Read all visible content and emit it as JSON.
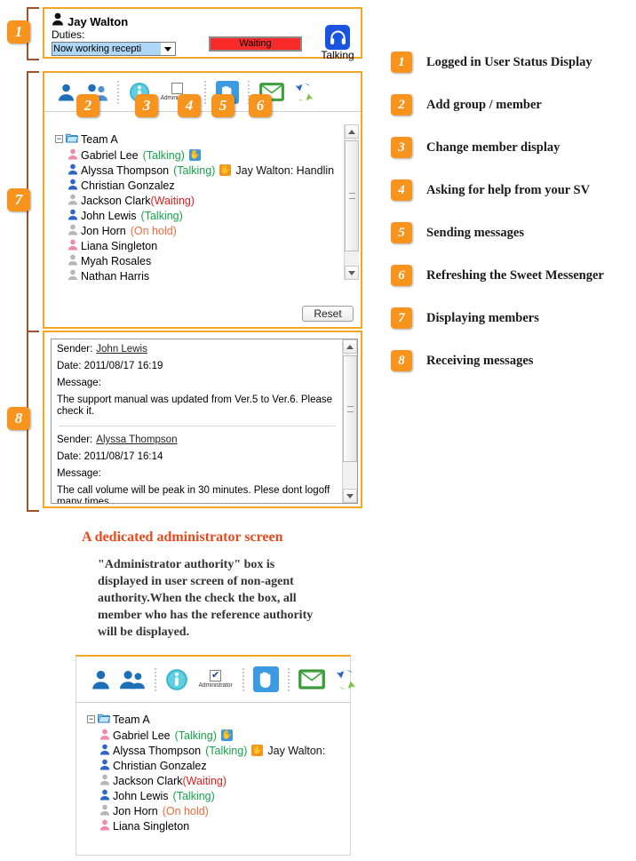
{
  "status": {
    "user_icon": "person-icon",
    "user_name": "Jay Walton",
    "duties_label": "Duties:",
    "duties_value": "Now working recepti",
    "waiting_button": "Waiting",
    "talking_label": "Talking",
    "talking_icon": "headset-icon",
    "waiting_color": "#f82a2a",
    "talking_color": "#1a53e0"
  },
  "toolbar": {
    "add_member_icon": "add-member-icon",
    "add_group_icon": "add-group-icon",
    "info_icon": "info-icon",
    "admin_checkbox_label": "Administrator",
    "admin_checkbox_checked_top": false,
    "admin_checkbox_checked_bottom": true,
    "raise_hand_icon": "raise-hand-icon",
    "mail_icon": "mail-envelope-icon",
    "refresh_icon": "refresh-arrows-icon"
  },
  "tree": {
    "root_label": "Team A",
    "folder_icon": "folder-open-icon",
    "expander": "−",
    "members": [
      {
        "name": "Gabriel Lee",
        "icon_color": "#f08aa8",
        "status": "(Talking)",
        "status_type": "talking",
        "hand": "blue",
        "message": ""
      },
      {
        "name": "Alyssa Thompson",
        "icon_color": "#2e63c8",
        "status": "(Talking)",
        "status_type": "talking",
        "hand": "orange",
        "message": "Jay Walton: Handlin"
      },
      {
        "name": "Christian Gonzalez",
        "icon_color": "#2e63c8",
        "status": "",
        "status_type": "none",
        "hand": "",
        "message": ""
      },
      {
        "name": "Jackson Clark",
        "icon_color": "#b6b6b6",
        "status": "(Waiting)",
        "status_type": "waiting",
        "hand": "",
        "message": ""
      },
      {
        "name": "John Lewis",
        "icon_color": "#2e63c8",
        "status": "(Talking)",
        "status_type": "talking",
        "hand": "",
        "message": ""
      },
      {
        "name": "Jon Horn",
        "icon_color": "#b6b6b6",
        "status": "(On hold)",
        "status_type": "hold",
        "hand": "",
        "message": ""
      },
      {
        "name": "Liana Singleton",
        "icon_color": "#f08aa8",
        "status": "",
        "status_type": "none",
        "hand": "",
        "message": ""
      },
      {
        "name": "Myah Rosales",
        "icon_color": "#b6b6b6",
        "status": "",
        "status_type": "none",
        "hand": "",
        "message": ""
      },
      {
        "name": "Nathan Harris",
        "icon_color": "#b6b6b6",
        "status": "",
        "status_type": "none",
        "hand": "",
        "message": ""
      }
    ]
  },
  "reset_button": "Reset",
  "messages": {
    "sender_label": "Sender:",
    "date_label": "Date:",
    "message_label": "Message:",
    "items": [
      {
        "sender": "John Lewis",
        "date": "2011/08/17 16:19",
        "body": "The support manual was updated from Ver.5 to Ver.6. Please check it."
      },
      {
        "sender": "Alyssa Thompson",
        "date": "2011/08/17 16:14",
        "body": "The call volume will be peak in 30 minutes. Plese dont logoff many times."
      }
    ]
  },
  "legend": {
    "items": [
      {
        "num": "1",
        "label": "Logged in User Status Display"
      },
      {
        "num": "2",
        "label": "Add group / member"
      },
      {
        "num": "3",
        "label": "Change member display"
      },
      {
        "num": "4",
        "label": "Asking for help from your SV"
      },
      {
        "num": "5",
        "label": "Sending messages"
      },
      {
        "num": "6",
        "label": "Refreshing the Sweet Messenger"
      },
      {
        "num": "7",
        "label": "Displaying members"
      },
      {
        "num": "8",
        "label": "Receiving messages"
      }
    ]
  },
  "callouts": {
    "b1": "1",
    "b2": "2",
    "b3": "3",
    "b4": "4",
    "b5": "5",
    "b6": "6",
    "b7": "7",
    "b8": "8"
  },
  "section": {
    "title": "A dedicated administrator screen",
    "body": "\"Administrator authority\" box is displayed in user screen of non-agent authority.When the check the box, all member who has the reference authority will be displayed."
  },
  "admin_tree": {
    "root_label": "Team A",
    "members": [
      {
        "name": "Gabriel Lee",
        "icon_color": "#f08aa8",
        "status": "(Talking)",
        "status_type": "talking",
        "hand": "blue",
        "message": ""
      },
      {
        "name": "Alyssa Thompson",
        "icon_color": "#2e63c8",
        "status": "(Talking)",
        "status_type": "talking",
        "hand": "orange",
        "message": "Jay Walton:"
      },
      {
        "name": "Christian Gonzalez",
        "icon_color": "#2e63c8",
        "status": "",
        "status_type": "none",
        "hand": "",
        "message": ""
      },
      {
        "name": "Jackson Clark",
        "icon_color": "#b6b6b6",
        "status": "(Waiting)",
        "status_type": "waiting",
        "hand": "",
        "message": ""
      },
      {
        "name": "John Lewis",
        "icon_color": "#2e63c8",
        "status": "(Talking)",
        "status_type": "talking",
        "hand": "",
        "message": ""
      },
      {
        "name": "Jon Horn",
        "icon_color": "#b6b6b6",
        "status": "(On hold)",
        "status_type": "hold",
        "hand": "",
        "message": ""
      },
      {
        "name": "Liana Singleton",
        "icon_color": "#f08aa8",
        "status": "",
        "status_type": "none",
        "hand": "",
        "message": ""
      }
    ]
  },
  "colors": {
    "accent_orange": "#f7941e",
    "frame_orange": "#f5a623",
    "bracket_brown": "#a0522d",
    "talking_green": "#16a34a",
    "waiting_red": "#e11d1d",
    "hold_orange": "#f06a3c",
    "title_red": "#e8491d"
  }
}
